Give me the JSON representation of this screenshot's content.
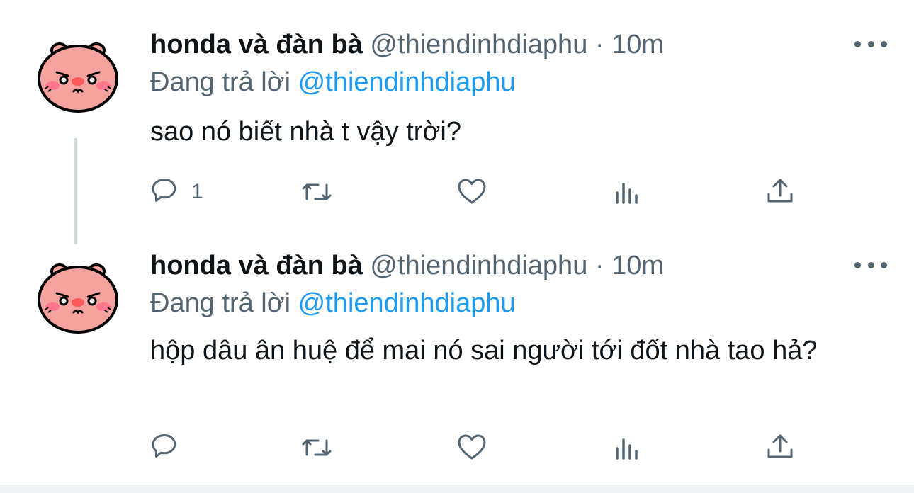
{
  "tweets": [
    {
      "display_name": "honda và đàn bà",
      "handle": "@thiendinhdiaphu",
      "separator": "·",
      "time": "10m",
      "reply_prefix": "Đang trả lời",
      "reply_mention": "@thiendinhdiaphu",
      "text": "sao nó biết nhà t vậy trời?",
      "reply_count": "1",
      "avatar_icon": "pink-pig-avatar-icon"
    },
    {
      "display_name": "honda và đàn bà",
      "handle": "@thiendinhdiaphu",
      "separator": "·",
      "time": "10m",
      "reply_prefix": "Đang trả lời",
      "reply_mention": "@thiendinhdiaphu",
      "text": "hộp dâu ân huệ để mai nó sai người tới đốt nhà tao hả?",
      "reply_count": "",
      "avatar_icon": "pink-pig-avatar-icon"
    }
  ],
  "icons": [
    "reply-icon",
    "retweet-icon",
    "like-icon",
    "analytics-icon",
    "share-icon",
    "more-options-icon"
  ],
  "colors": {
    "text": "#0f1419",
    "secondary": "#536471",
    "mention": "#1d9bf0",
    "thread_line": "#cfd9de",
    "avatar_pink": "#f6a3a0"
  }
}
